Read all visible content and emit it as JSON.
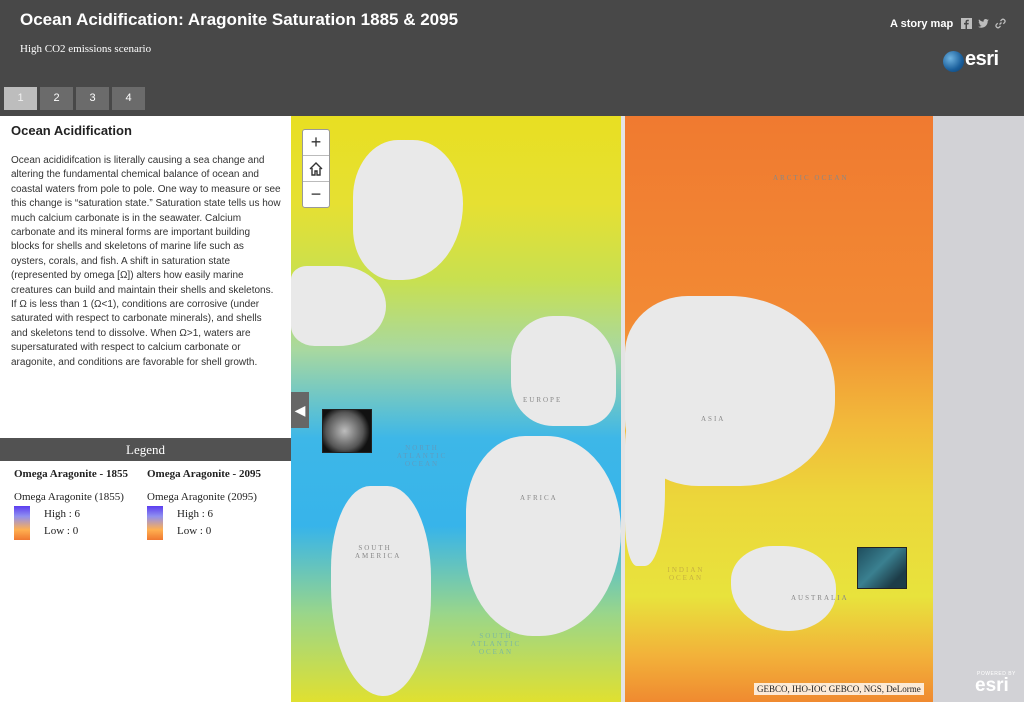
{
  "header": {
    "title": "Ocean Acidification: Aragonite Saturation 1885 & 2095",
    "subtitle": "High CO2 emissions scenario",
    "story_map_label": "A story map",
    "social_icons": [
      "facebook-icon",
      "twitter-icon",
      "link-icon"
    ],
    "logo_text": "esri"
  },
  "tabs": [
    {
      "label": "1",
      "active": true
    },
    {
      "label": "2",
      "active": false
    },
    {
      "label": "3",
      "active": false
    },
    {
      "label": "4",
      "active": false
    }
  ],
  "panel": {
    "title": "Ocean Acidification",
    "body": "Ocean acididifcation is literally causing a sea change and altering the fundamental chemical balance of ocean and coastal waters from pole to pole.  One way to measure or see this change is “saturation state.” Saturation state tells us how much calcium carbonate is in the seawater.  Calcium carbonate and its mineral forms are important building blocks for shells and skeletons of marine life such as oysters, corals, and fish.  A shift in saturation state (represented by omega [Ω]) alters how easily marine creatures can build and maintain their shells and skeletons.  If Ω is less than 1 (Ω<1), conditions are corrosive (under saturated with respect to carbonate minerals), and shells and skeletons tend to dissolve. When Ω>1, waters are supersaturated with respect to calcium carbonate or aragonite, and conditions are favorable for shell growth."
  },
  "legend": {
    "header": "Legend",
    "layers": [
      {
        "title": "Omega Aragonite - 1855",
        "subtitle": "Omega Aragonite (1855)",
        "high": "High : 6",
        "low": "Low : 0"
      },
      {
        "title": "Omega Aragonite - 2095",
        "subtitle": "Omega Aragonite (2095)",
        "high": "High : 6",
        "low": "Low : 0"
      }
    ]
  },
  "map": {
    "zoom_in": "+",
    "zoom_out": "−",
    "home_icon": "home-icon",
    "swipe_handle_icon": "chevron-left-icon",
    "labels": {
      "arctic": "ARCTIC OCEAN",
      "europe": "EUROPE",
      "africa": "AFRICA",
      "asia": "ASIA",
      "south_america": "SOUTH AMERICA",
      "north_atlantic": "NORTH ATLANTIC OCEAN",
      "south_atlantic": "SOUTH ATLANTIC OCEAN",
      "indian": "INDIAN OCEAN",
      "australia": "AUSTRALIA"
    },
    "attribution": "GEBCO, IHO-IOC GEBCO, NGS, DeLorme",
    "powered_by": "POWERED BY",
    "powered_logo": "esri",
    "colors": {
      "past_ocean": "#3db7e8",
      "future_ocean": "#f07a30",
      "land": "#e9e9e9"
    }
  }
}
